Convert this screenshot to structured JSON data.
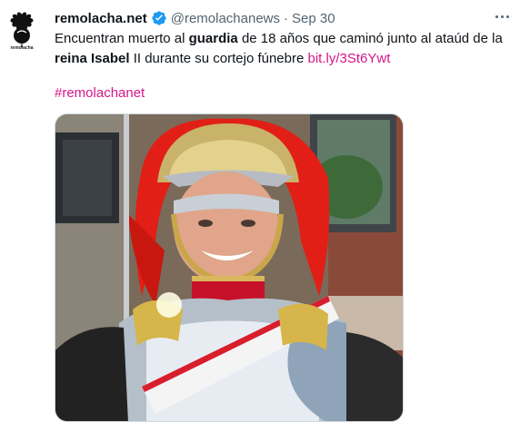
{
  "account": {
    "display_name": "remolacha.net",
    "handle": "@remolachanews",
    "separator": "·",
    "date": "Sep 30",
    "avatar_caption": "remolacha"
  },
  "tweet": {
    "text_1": "Encuentran muerto al ",
    "bold_1": "guardia",
    "text_2": " de 18 años que caminó junto al ataúd de la ",
    "bold_2": "reina Isabel",
    "text_3": " II durante su cortejo fúnebre ",
    "link": "bit.ly/3St6Ywt",
    "hashtag": "#remolachanet"
  },
  "colors": {
    "link": "#d6168a",
    "verified": "#1d9bf0",
    "secondary_text": "#536471"
  },
  "icons": {
    "verified": "verified-badge-icon",
    "more": "more-options-icon"
  }
}
